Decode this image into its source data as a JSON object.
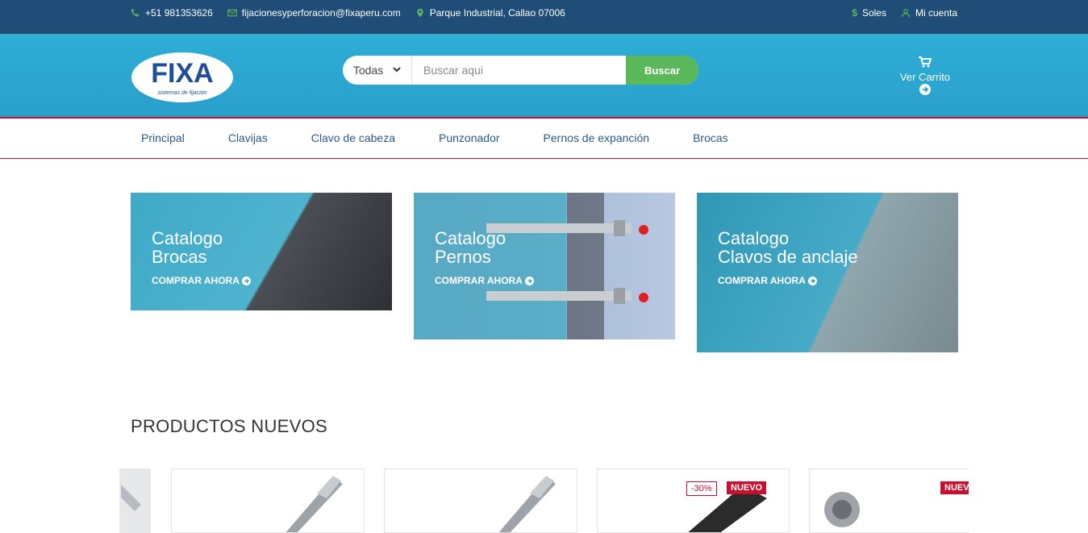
{
  "topbar": {
    "phone": "+51 981353626",
    "email": "fijacionesyperforacion@fixaperu.com",
    "address": "Parque Industrial, Callao 07006",
    "currency": "Soles",
    "account": "Mi cuenta"
  },
  "header": {
    "logo_text": "FIXA",
    "logo_tagline": "sistemas de fijación",
    "search": {
      "category": "Todas",
      "placeholder": "Buscar aqui",
      "button": "Buscar"
    },
    "cart_label": "Ver Carrito"
  },
  "nav": {
    "items": [
      "Principal",
      "Clavijas",
      "Clavo de cabeza",
      "Punzonador",
      "Pernos de expanción",
      "Brocas"
    ]
  },
  "banners": [
    {
      "line1": "Catalogo",
      "line2": "Brocas",
      "cta": "COMPRAR AHORA"
    },
    {
      "line1": "Catalogo",
      "line2": "Pernos",
      "cta": "COMPRAR AHORA"
    },
    {
      "line1": "Catalogo",
      "line2": "Clavos de anclaje",
      "cta": "COMPRAR AHORA"
    }
  ],
  "products_section": {
    "title": "PRODUCTOS NUEVOS",
    "cards": [
      {
        "badges": []
      },
      {
        "badges": []
      },
      {
        "badge_sale": "-30%",
        "badge_new": "NUEVO"
      },
      {
        "badge_new": "NUEVO"
      }
    ]
  },
  "colors": {
    "topbar": "#1f4d78",
    "header": "#2eaed6",
    "accent_red": "#c8102e",
    "search_button": "#5bb85a",
    "nav_text": "#2b5a8a"
  }
}
